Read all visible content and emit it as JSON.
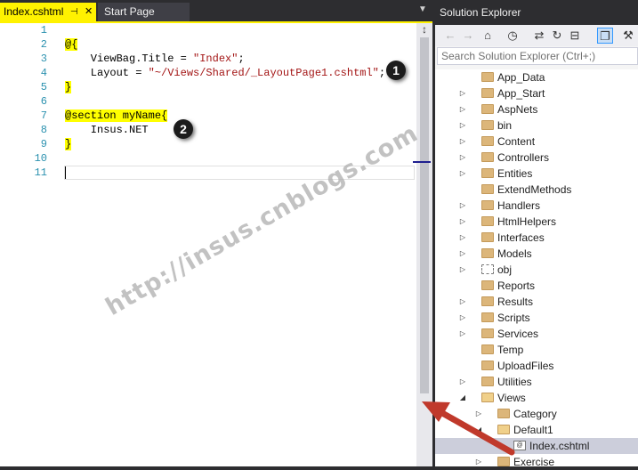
{
  "editor": {
    "tabs": [
      {
        "label": "Index.cshtml",
        "active": true
      },
      {
        "label": "Start Page",
        "active": false
      }
    ],
    "lines": [
      {
        "num": "1",
        "segments": []
      },
      {
        "num": "2",
        "segments": [
          {
            "text": "@{",
            "type": "razor"
          }
        ]
      },
      {
        "num": "3",
        "segments": [
          {
            "text": "    ViewBag.Title = ",
            "type": "plain"
          },
          {
            "text": "\"Index\"",
            "type": "string"
          },
          {
            "text": ";",
            "type": "plain"
          }
        ]
      },
      {
        "num": "4",
        "segments": [
          {
            "text": "    Layout = ",
            "type": "plain"
          },
          {
            "text": "\"~/Views/Shared/_LayoutPage1.cshtml\"",
            "type": "string"
          },
          {
            "text": ";",
            "type": "plain"
          }
        ]
      },
      {
        "num": "5",
        "segments": [
          {
            "text": "}",
            "type": "razor"
          }
        ]
      },
      {
        "num": "6",
        "segments": []
      },
      {
        "num": "7",
        "segments": [
          {
            "text": "@section myName{",
            "type": "razor"
          }
        ]
      },
      {
        "num": "8",
        "segments": [
          {
            "text": "    Insus.NET",
            "type": "plain"
          }
        ]
      },
      {
        "num": "9",
        "segments": [
          {
            "text": "}",
            "type": "razor"
          }
        ]
      },
      {
        "num": "10",
        "segments": []
      },
      {
        "num": "11",
        "segments": []
      }
    ],
    "current_line": "11",
    "badges": [
      "1",
      "2"
    ],
    "watermark": "http://insus.cnblogs.com"
  },
  "solution_explorer": {
    "title": "Solution Explorer",
    "search_placeholder": "Search Solution Explorer (Ctrl+;)",
    "toolbar_icons": [
      "back-icon",
      "forward-icon",
      "home-icon",
      "history-icon",
      "sync-icon",
      "refresh-icon",
      "collapse-all-icon",
      "show-all-files-icon",
      "properties-icon"
    ],
    "tree": [
      {
        "label": "App_Data",
        "level": 0,
        "expander": "none",
        "icon": "folder"
      },
      {
        "label": "App_Start",
        "level": 0,
        "expander": "collapsed",
        "icon": "folder"
      },
      {
        "label": "AspNets",
        "level": 0,
        "expander": "collapsed",
        "icon": "folder"
      },
      {
        "label": "bin",
        "level": 0,
        "expander": "collapsed",
        "icon": "folder"
      },
      {
        "label": "Content",
        "level": 0,
        "expander": "collapsed",
        "icon": "folder"
      },
      {
        "label": "Controllers",
        "level": 0,
        "expander": "collapsed",
        "icon": "folder"
      },
      {
        "label": "Entities",
        "level": 0,
        "expander": "collapsed",
        "icon": "folder"
      },
      {
        "label": "ExtendMethods",
        "level": 0,
        "expander": "none",
        "icon": "folder"
      },
      {
        "label": "Handlers",
        "level": 0,
        "expander": "collapsed",
        "icon": "folder"
      },
      {
        "label": "HtmlHelpers",
        "level": 0,
        "expander": "collapsed",
        "icon": "folder"
      },
      {
        "label": "Interfaces",
        "level": 0,
        "expander": "collapsed",
        "icon": "folder"
      },
      {
        "label": "Models",
        "level": 0,
        "expander": "collapsed",
        "icon": "folder"
      },
      {
        "label": "obj",
        "level": 0,
        "expander": "collapsed",
        "icon": "folder-dashed"
      },
      {
        "label": "Reports",
        "level": 0,
        "expander": "none",
        "icon": "folder"
      },
      {
        "label": "Results",
        "level": 0,
        "expander": "collapsed",
        "icon": "folder"
      },
      {
        "label": "Scripts",
        "level": 0,
        "expander": "collapsed",
        "icon": "folder"
      },
      {
        "label": "Services",
        "level": 0,
        "expander": "collapsed",
        "icon": "folder"
      },
      {
        "label": "Temp",
        "level": 0,
        "expander": "none",
        "icon": "folder"
      },
      {
        "label": "UploadFiles",
        "level": 0,
        "expander": "none",
        "icon": "folder"
      },
      {
        "label": "Utilities",
        "level": 0,
        "expander": "collapsed",
        "icon": "folder"
      },
      {
        "label": "Views",
        "level": 0,
        "expander": "expanded",
        "icon": "folder-open"
      },
      {
        "label": "Category",
        "level": 1,
        "expander": "collapsed",
        "icon": "folder"
      },
      {
        "label": "Default1",
        "level": 1,
        "expander": "expanded",
        "icon": "folder-open"
      },
      {
        "label": "Index.cshtml",
        "level": 2,
        "expander": "none",
        "icon": "cshtml-file",
        "selected": true
      },
      {
        "label": "Exercise",
        "level": 1,
        "expander": "collapsed",
        "icon": "folder"
      }
    ]
  },
  "colors": {
    "active_tab": "#fff200",
    "line_numbers": "#2b91af",
    "string": "#a31515",
    "razor_highlight": "#ffff00",
    "arrow": "#c0392b",
    "selection": "#cccedb"
  }
}
